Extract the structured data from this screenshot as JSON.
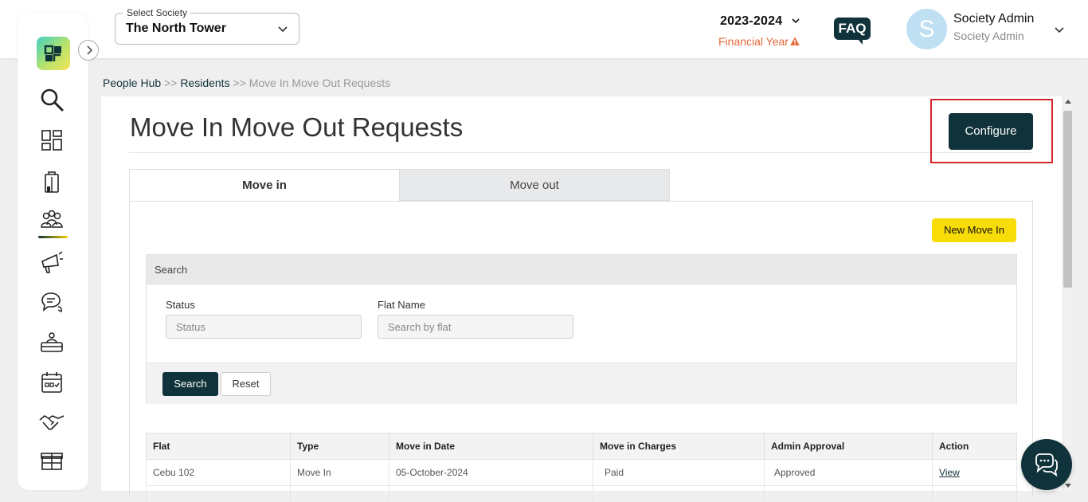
{
  "header": {
    "society_label": "Select Society",
    "society_value": "The North Tower",
    "financial_year": "2023-2024",
    "financial_year_label": "Financial Year",
    "faq_label": "FAQ",
    "avatar_initial": "S",
    "user_name": "Society Admin",
    "user_role": "Society Admin"
  },
  "sidebar": {
    "items": [
      {
        "icon": "search-icon"
      },
      {
        "icon": "dashboard-icon"
      },
      {
        "icon": "building-icon"
      },
      {
        "icon": "people-icon",
        "active": true
      },
      {
        "icon": "megaphone-icon"
      },
      {
        "icon": "chat-bubbles-icon"
      },
      {
        "icon": "helpdesk-icon"
      },
      {
        "icon": "calendar-icon"
      },
      {
        "icon": "handshake-icon"
      },
      {
        "icon": "box-icon"
      }
    ]
  },
  "breadcrumb": {
    "level1": "People Hub",
    "sep1": ">>",
    "level2": "Residents",
    "sep2": ">>",
    "current": "Move In Move Out Requests"
  },
  "page": {
    "title": "Move In Move Out Requests",
    "configure_label": "Configure",
    "tabs": [
      {
        "label": "Move in",
        "active": true
      },
      {
        "label": "Move out",
        "active": false
      }
    ],
    "new_move_in_label": "New Move In"
  },
  "search": {
    "heading": "Search",
    "status_label": "Status",
    "status_placeholder": "Status",
    "flat_label": "Flat Name",
    "flat_placeholder": "Search by flat",
    "search_button": "Search",
    "reset_button": "Reset"
  },
  "table": {
    "columns": [
      "Flat",
      "Type",
      "Move in Date",
      "Move in Charges",
      "Admin Approval",
      "Action"
    ],
    "rows": [
      {
        "flat": "Cebu 102",
        "type": "Move In",
        "date": "05-October-2024",
        "charges": "Paid",
        "approval": "Approved",
        "action": "View"
      }
    ]
  },
  "colors": {
    "brand_dark": "#10323a",
    "accent_yellow": "#f8dc08",
    "warning_orange": "#e5673a",
    "highlight_red": "#d9262c"
  }
}
